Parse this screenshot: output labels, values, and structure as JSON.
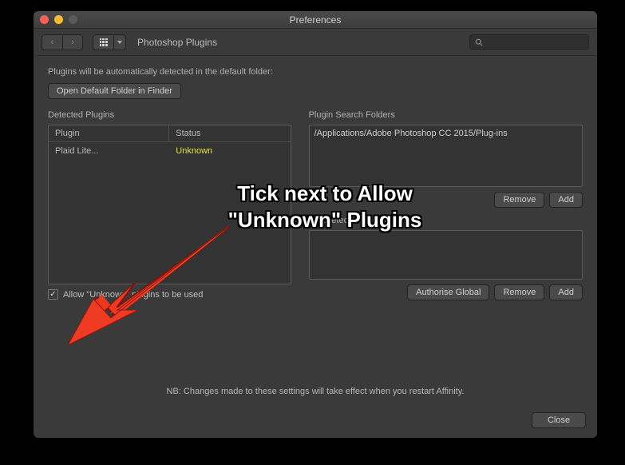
{
  "window": {
    "title": "Preferences"
  },
  "toolbar": {
    "breadcrumb": "Photoshop Plugins",
    "search_placeholder": ""
  },
  "hint": "Plugins will be automatically detected in the default folder:",
  "buttons": {
    "open_default_folder": "Open Default Folder in Finder",
    "remove": "Remove",
    "add": "Add",
    "authorise_global": "Authorise Global",
    "close": "Close"
  },
  "sections": {
    "detected": "Detected Plugins",
    "search_folders": "Plugin Search Folders",
    "autodetect": "Autodetected plugin …"
  },
  "table": {
    "headers": {
      "plugin": "Plugin",
      "status": "Status"
    },
    "rows": [
      {
        "plugin": "Plaid Lite...",
        "status": "Unknown"
      }
    ]
  },
  "search_folders": {
    "items": [
      "/Applications/Adobe Photoshop CC 2015/Plug-ins"
    ]
  },
  "checkbox": {
    "allow_unknown_label": "Allow \"Unknown\" plugins to be used",
    "checked": true
  },
  "footer_note": "NB: Changes made to these settings will take effect when you restart Affinity.",
  "annotation": {
    "line1": "Tick next to Allow",
    "line2": "\"Unknown\" Plugins"
  },
  "icons": {
    "back": "‹",
    "forward": "›"
  }
}
